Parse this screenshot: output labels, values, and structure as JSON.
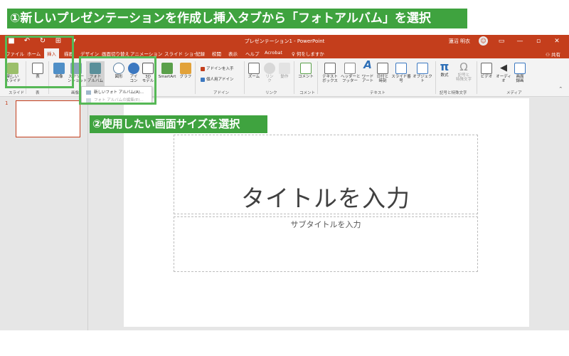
{
  "window": {
    "title": "プレゼンテーション1 - PowerPoint",
    "user": "蓮沼 明衣",
    "share": "共有"
  },
  "colors": {
    "brand": "#c43e1c",
    "annotation": "#3fa33f"
  },
  "tabs": [
    {
      "label": "ファイル"
    },
    {
      "label": "ホーム"
    },
    {
      "label": "挿入"
    },
    {
      "label": "描画"
    },
    {
      "label": "デザイン"
    },
    {
      "label": "画面切り替え"
    },
    {
      "label": "アニメーション"
    },
    {
      "label": "スライド ショー"
    },
    {
      "label": "記録"
    },
    {
      "label": "校閲"
    },
    {
      "label": "表示"
    },
    {
      "label": "ヘルプ"
    },
    {
      "label": "Acrobat"
    },
    {
      "label": "何をしますか"
    }
  ],
  "ribbon": {
    "new_slide": "新しい\nスライド",
    "table": "表",
    "image": "画像",
    "screenshot": "スクリー\nンショット",
    "photo_album": "フォト\nアルバム",
    "shapes": "図形",
    "icons": "アイ\nコン",
    "model3d": "3D\nモデル",
    "smartart": "SmartArt",
    "chart": "グラフ",
    "get_addins": "アドインを入手",
    "my_addins": "個人用アドイン",
    "zoom": "ズーム",
    "link": "リン\nク",
    "action": "動作",
    "comment": "コメント",
    "textbox": "テキスト\nボックス",
    "header_footer": "ヘッダーと\nフッター",
    "wordart": "ワード\nアート",
    "datetime": "日付と\n時刻",
    "slide_number": "スライド番号",
    "object": "オブジェクト",
    "equation": "数式",
    "symbol": "記号と\n特殊文字",
    "video": "ビデオ",
    "audio": "オーディオ",
    "screen_record": "画面\n録画",
    "groups": {
      "slides": "スライド",
      "tables": "表",
      "images": "画像",
      "addins": "アドイン",
      "links": "リンク",
      "comments": "コメント",
      "text": "テキスト",
      "symbols": "記号と特殊文字",
      "media": "メディア"
    }
  },
  "dropdown": {
    "new_album": "新しいフォト アルバム(A)...",
    "edit_album": "フォト アルバムの編集(E)..."
  },
  "thumbnail": {
    "number": "1"
  },
  "slide": {
    "title_placeholder": "タイトルを入力",
    "subtitle_placeholder": "サブタイトルを入力"
  },
  "annotations": {
    "step1": "①新しいプレゼンテーションを作成し挿入タブから「フォトアルバム」を選択",
    "step2": "②使用したい画面サイズを選択"
  }
}
